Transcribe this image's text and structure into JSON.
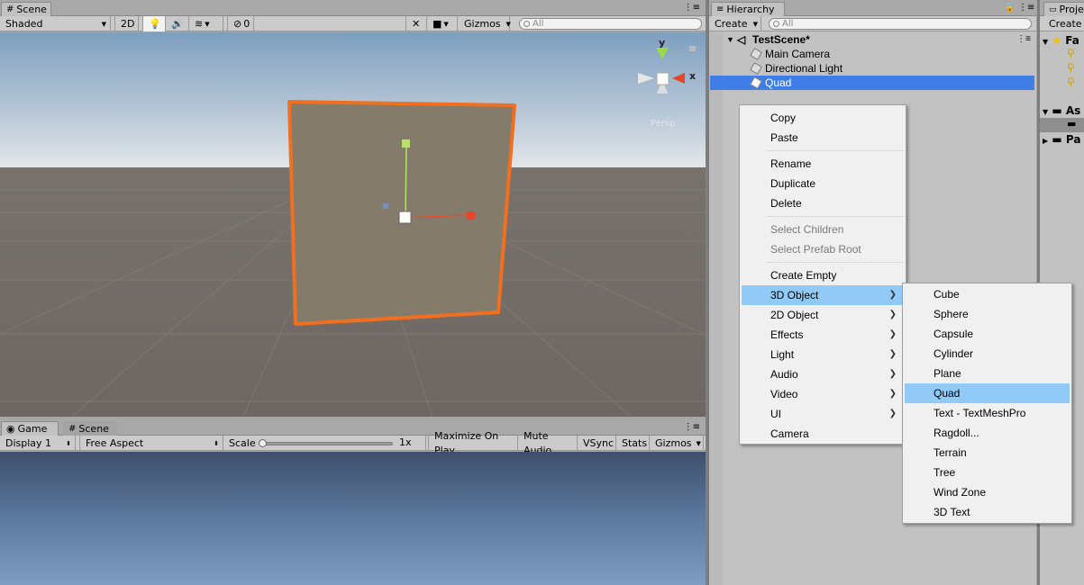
{
  "scene_panel": {
    "tab": "Scene",
    "shading": "Shaded",
    "btn_2d": "2D",
    "audio_count": "0",
    "gizmos": "Gizmos",
    "search_placeholder": "All",
    "axis_y": "y",
    "axis_x": "x",
    "persp": "Persp"
  },
  "game_panel": {
    "tabs": [
      "Game",
      "Scene"
    ],
    "display": "Display 1",
    "aspect": "Free Aspect",
    "scale_label": "Scale",
    "scale_value": "1x",
    "maximize": "Maximize On Play",
    "mute": "Mute Audio",
    "vsync": "VSync",
    "stats": "Stats",
    "gizmos": "Gizmos",
    "scale_fraction": 0.0
  },
  "hierarchy": {
    "tab": "Hierarchy",
    "create": "Create",
    "search_placeholder": "All",
    "scene_name": "TestScene*",
    "items": [
      "Main Camera",
      "Directional Light",
      "Quad"
    ],
    "selected": "Quad"
  },
  "project": {
    "tab": "Proje",
    "create": "Create",
    "fav": "Fa",
    "assets": "As",
    "packages": "Pa"
  },
  "context_menu": {
    "items": [
      {
        "label": "Copy"
      },
      {
        "label": "Paste"
      },
      {
        "label": "Rename"
      },
      {
        "label": "Duplicate"
      },
      {
        "label": "Delete"
      },
      {
        "label": "Select Children",
        "disabled": true
      },
      {
        "label": "Select Prefab Root",
        "disabled": true
      },
      {
        "label": "Create Empty"
      },
      {
        "label": "3D Object",
        "submenu": true,
        "highlighted": true
      },
      {
        "label": "2D Object",
        "submenu": true
      },
      {
        "label": "Effects",
        "submenu": true
      },
      {
        "label": "Light",
        "submenu": true
      },
      {
        "label": "Audio",
        "submenu": true
      },
      {
        "label": "Video",
        "submenu": true
      },
      {
        "label": "UI",
        "submenu": true
      },
      {
        "label": "Camera"
      }
    ]
  },
  "submenu_3d": {
    "items": [
      "Cube",
      "Sphere",
      "Capsule",
      "Cylinder",
      "Plane",
      "Quad",
      "Text - TextMeshPro",
      "Ragdoll...",
      "Terrain",
      "Tree",
      "Wind Zone",
      "3D Text"
    ],
    "highlighted": "Quad"
  },
  "colors": {
    "selection": "#3e7ee6",
    "menu_highlight": "#91c9f7",
    "quad_outline": "#f07020",
    "quad_fill": "#857b6a"
  }
}
